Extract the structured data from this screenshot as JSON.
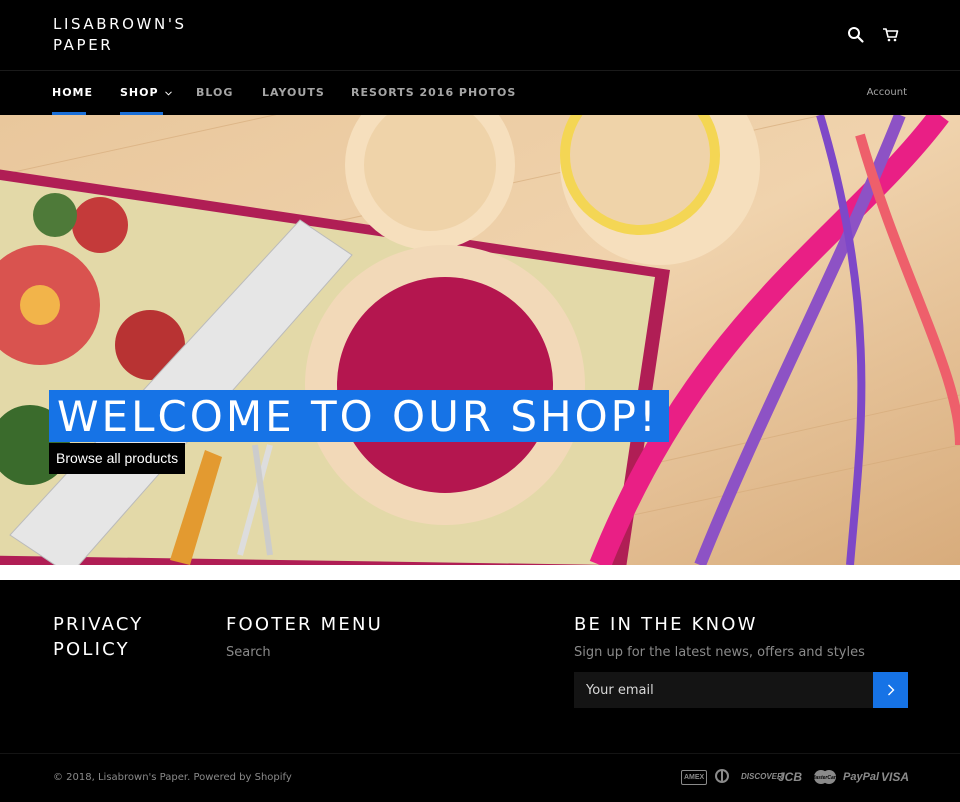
{
  "header": {
    "logo": "LISABROWN'S PAPER",
    "icons": [
      "search-icon",
      "cart-icon"
    ]
  },
  "nav": {
    "items": [
      {
        "label": "HOME"
      },
      {
        "label": "SHOP"
      },
      {
        "label": "BLOG"
      },
      {
        "label": "LAYOUTS"
      },
      {
        "label": "RESORTS 2016 PHOTOS"
      }
    ],
    "account": "Account"
  },
  "hero": {
    "title": "WELCOME TO OUR SHOP!",
    "button": "Browse all products"
  },
  "footer": {
    "col1_heading": "PRIVACY POLICY",
    "col2_heading": "FOOTER MENU",
    "col2_link": "Search",
    "col3_heading": "BE IN THE KNOW",
    "col3_sub": "Sign up for the latest news, offers and styles",
    "email_placeholder": "Your email",
    "copyright": "© 2018, Lisabrown's Paper.",
    "powered": "Powered by Shopify",
    "payments": [
      "AMEX",
      "diners",
      "DISCOVER",
      "JCB",
      "mastercard",
      "PayPal",
      "VISA"
    ]
  },
  "colors": {
    "accent": "#1673e6",
    "background": "#000000"
  }
}
